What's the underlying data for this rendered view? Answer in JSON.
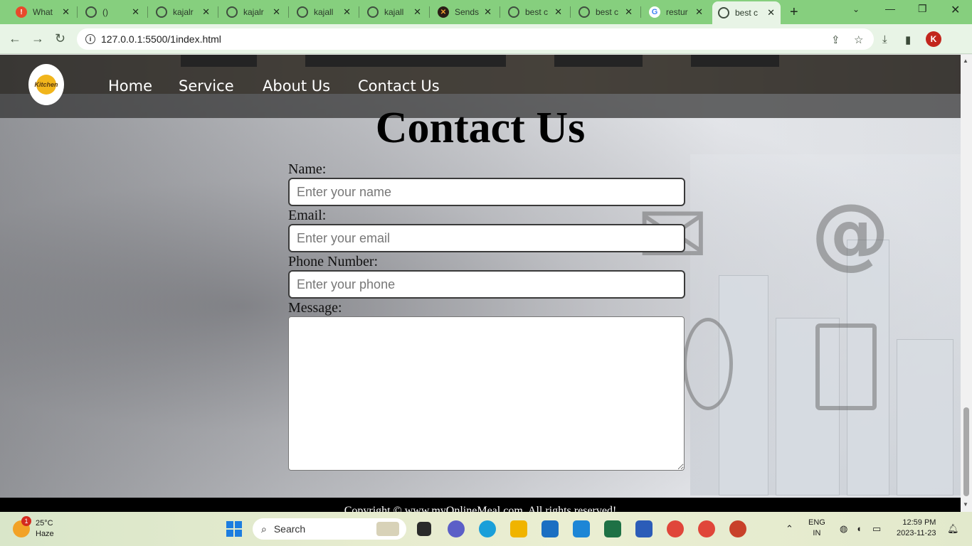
{
  "browser": {
    "tabs": [
      {
        "title": "What",
        "icon": "warning-icon"
      },
      {
        "title": "()",
        "icon": "globe-icon"
      },
      {
        "title": "kajalr",
        "icon": "globe-icon"
      },
      {
        "title": "kajalr",
        "icon": "globe-icon"
      },
      {
        "title": "kajall",
        "icon": "globe-icon"
      },
      {
        "title": "kajall",
        "icon": "globe-icon"
      },
      {
        "title": "Sends",
        "icon": "sendspace-icon"
      },
      {
        "title": "best c",
        "icon": "globe-icon"
      },
      {
        "title": "best c",
        "icon": "globe-icon"
      },
      {
        "title": "restur",
        "icon": "google-icon"
      },
      {
        "title": "best c",
        "icon": "globe-icon",
        "active": true
      }
    ],
    "url": "127.0.0.1:5500/1index.html",
    "profile_initial": "K"
  },
  "page": {
    "nav": {
      "links": [
        "Home",
        "Service",
        "About Us",
        "Contact Us"
      ],
      "logo_text": "Kitchen"
    },
    "heading": "Contact Us",
    "form": {
      "name_label": "Name:",
      "name_placeholder": "Enter your name",
      "email_label": "Email:",
      "email_placeholder": "Enter your email",
      "phone_label": "Phone Number:",
      "phone_placeholder": "Enter your phone",
      "message_label": "Message:"
    },
    "footer": "Copyright © www.myOnlineMeal.com. All rights reserved!"
  },
  "taskbar": {
    "weather": {
      "temp": "25°C",
      "condition": "Haze",
      "badge": "1"
    },
    "search_placeholder": "Search",
    "language": {
      "line1": "ENG",
      "line2": "IN"
    },
    "time": "12:59 PM",
    "date": "2023-11-23"
  },
  "colors": {
    "tabstrip": "#86cf7e",
    "toolbar": "#e8f4e6",
    "nav_overlay": "#323232",
    "footer": "#000000"
  }
}
